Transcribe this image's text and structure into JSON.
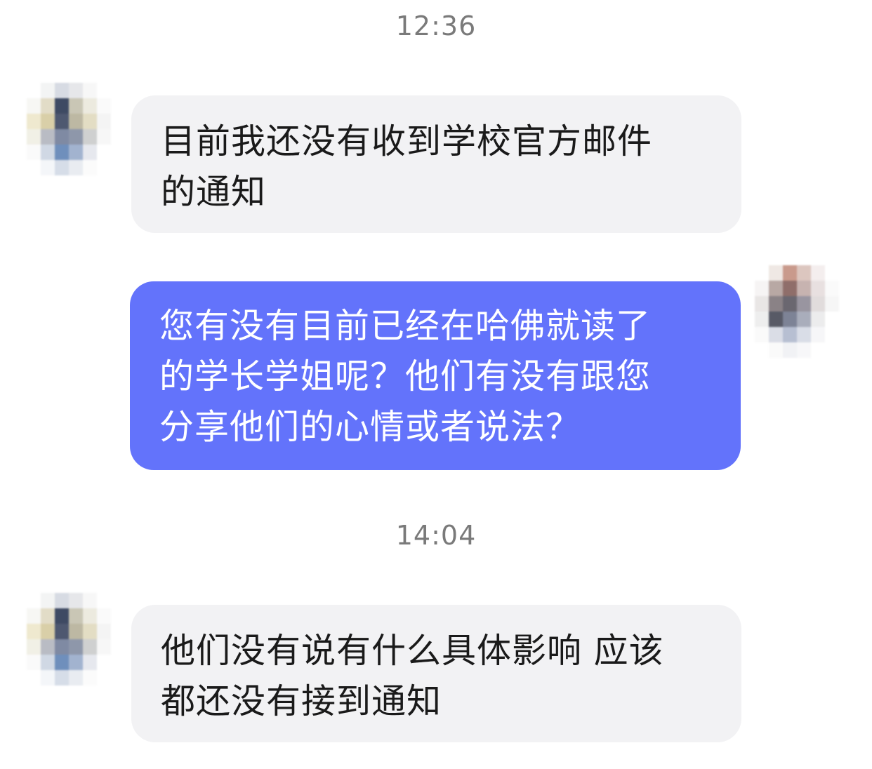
{
  "messages": [
    {
      "type": "timestamp",
      "text": "12:36"
    },
    {
      "type": "incoming",
      "avatar_icon": "blurred-avatar-icon",
      "text": "目前我还没有收到学校官方邮件\n的通知"
    },
    {
      "type": "outgoing",
      "avatar_icon": "blurred-avatar-icon",
      "text": "您有没有目前已经在哈佛就读了\n的学长学姐呢？他们有没有跟您\n分享他们的心情或者说法？"
    },
    {
      "type": "timestamp",
      "text": "14:04"
    },
    {
      "type": "incoming",
      "avatar_icon": "blurred-avatar-icon",
      "text": "他们没有说有什么具体影响 应该\n都还没有接到通知"
    }
  ],
  "colors": {
    "incoming_bubble": "#f2f2f4",
    "outgoing_bubble": "#6373fb",
    "timestamp_text": "#7a7a7a"
  }
}
